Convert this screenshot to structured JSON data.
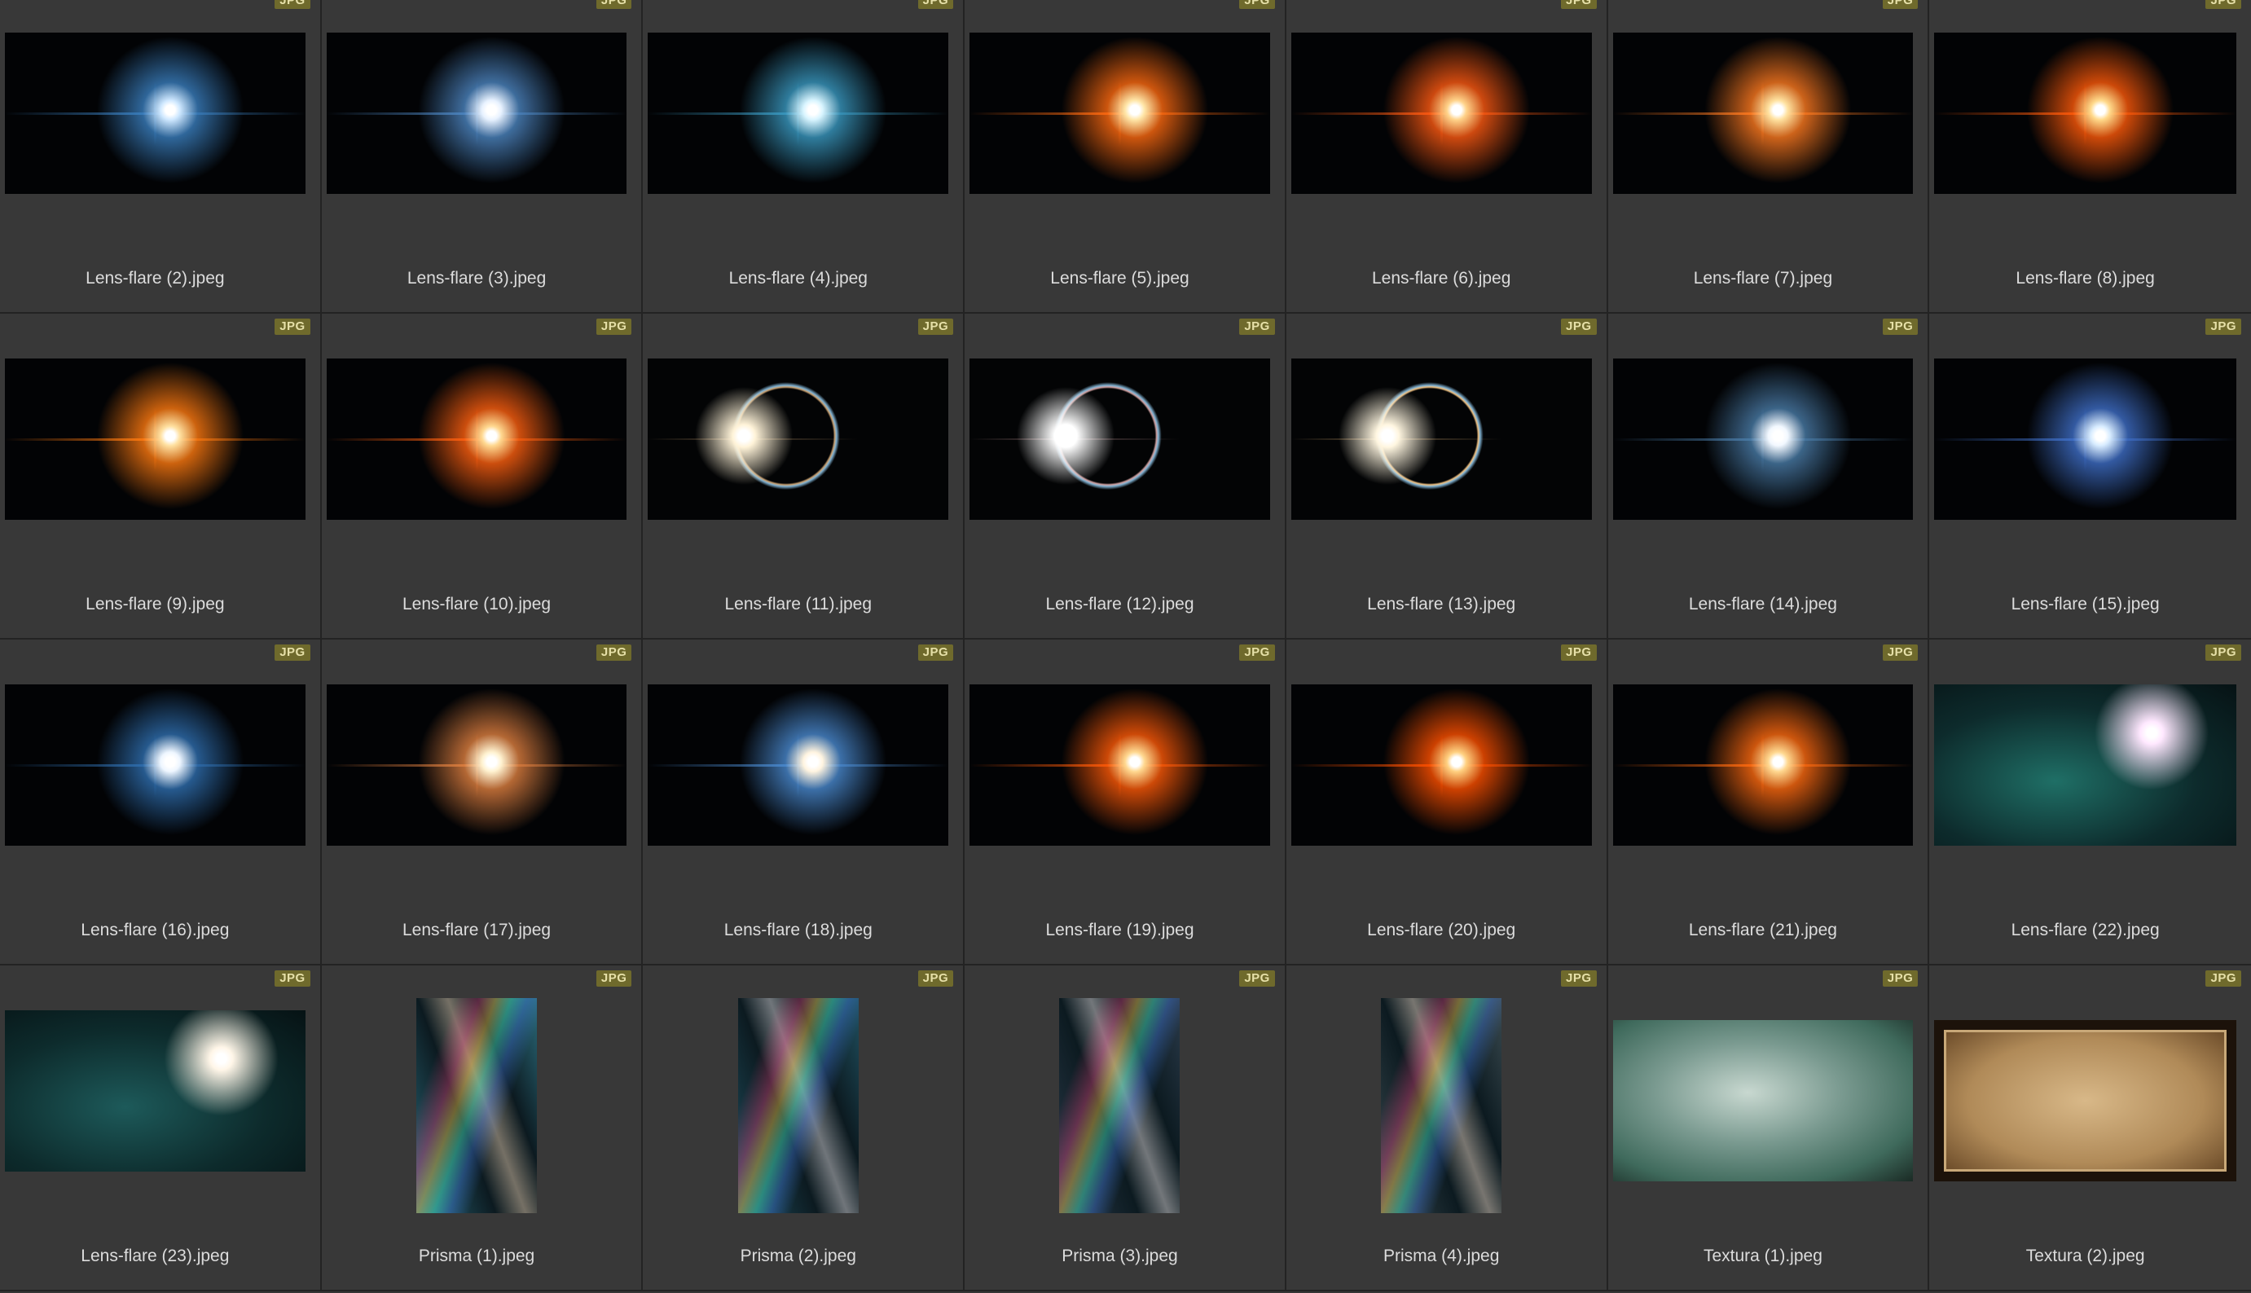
{
  "badge_label": "JPG",
  "items": [
    {
      "name": "Lens-flare (2).jpeg",
      "kind": "flare",
      "shape": "landscape",
      "glow": "#cfe8ff",
      "accent": "#3a7fbf"
    },
    {
      "name": "Lens-flare (3).jpeg",
      "kind": "flare",
      "shape": "landscape",
      "glow": "#e8f2ff",
      "accent": "#4d86c2"
    },
    {
      "name": "Lens-flare (4).jpeg",
      "kind": "flare",
      "shape": "landscape",
      "glow": "#d9f5ff",
      "accent": "#3a9ac2"
    },
    {
      "name": "Lens-flare (5).jpeg",
      "kind": "flare",
      "shape": "landscape",
      "glow": "#ffe6a8",
      "accent": "#ff6a10"
    },
    {
      "name": "Lens-flare (6).jpeg",
      "kind": "flare",
      "shape": "landscape",
      "glow": "#ffd38a",
      "accent": "#ff5a12"
    },
    {
      "name": "Lens-flare (7).jpeg",
      "kind": "flare",
      "shape": "landscape",
      "glow": "#ffe2a0",
      "accent": "#ff7a20"
    },
    {
      "name": "Lens-flare (8).jpeg",
      "kind": "flare",
      "shape": "landscape",
      "glow": "#ffd98a",
      "accent": "#ff5a0a"
    },
    {
      "name": "Lens-flare (9).jpeg",
      "kind": "flare",
      "shape": "landscape",
      "glow": "#ffe0a0",
      "accent": "#ff7a10"
    },
    {
      "name": "Lens-flare (10).jpeg",
      "kind": "flare",
      "shape": "landscape",
      "glow": "#ffd890",
      "accent": "#ff6010"
    },
    {
      "name": "Lens-flare (11).jpeg",
      "kind": "ring",
      "shape": "landscape",
      "glow": "#fff3d8",
      "accent": "#c9a070"
    },
    {
      "name": "Lens-flare (12).jpeg",
      "kind": "ring",
      "shape": "landscape",
      "glow": "#ffffff",
      "accent": "#d0a0a0"
    },
    {
      "name": "Lens-flare (13).jpeg",
      "kind": "ring",
      "shape": "landscape",
      "glow": "#fff6e0",
      "accent": "#f0c080"
    },
    {
      "name": "Lens-flare (14).jpeg",
      "kind": "flare",
      "shape": "landscape",
      "glow": "#f2f8ff",
      "accent": "#4a7ca8"
    },
    {
      "name": "Lens-flare (15).jpeg",
      "kind": "flare",
      "shape": "landscape",
      "glow": "#d8ecff",
      "accent": "#3f6fc8"
    },
    {
      "name": "Lens-flare (16).jpeg",
      "kind": "flare",
      "shape": "landscape",
      "glow": "#eef6ff",
      "accent": "#2f6fb0"
    },
    {
      "name": "Lens-flare (17).jpeg",
      "kind": "flare",
      "shape": "landscape",
      "glow": "#fff2d0",
      "accent": "#e08040"
    },
    {
      "name": "Lens-flare (18).jpeg",
      "kind": "flare",
      "shape": "landscape",
      "glow": "#fff4e0",
      "accent": "#4a8ad0"
    },
    {
      "name": "Lens-flare (19).jpeg",
      "kind": "flare",
      "shape": "landscape",
      "glow": "#ffd890",
      "accent": "#ff5a08"
    },
    {
      "name": "Lens-flare (20).jpeg",
      "kind": "flare",
      "shape": "landscape",
      "glow": "#ffd080",
      "accent": "#ff5000"
    },
    {
      "name": "Lens-flare (21).jpeg",
      "kind": "flare",
      "shape": "landscape",
      "glow": "#ffd890",
      "accent": "#ff6a10"
    },
    {
      "name": "Lens-flare (22).jpeg",
      "kind": "teal",
      "shape": "landscape",
      "glow": "#ffe8ff",
      "accent": "#1f6f66"
    },
    {
      "name": "Lens-flare (23).jpeg",
      "kind": "teal",
      "shape": "landscape",
      "glow": "#fff6e8",
      "accent": "#1d5a5a"
    },
    {
      "name": "Prisma (1).jpeg",
      "kind": "prism",
      "shape": "portrait",
      "glow": "#f0e0c0",
      "accent": "#2a6a7a"
    },
    {
      "name": "Prisma (2).jpeg",
      "kind": "prism",
      "shape": "portrait",
      "glow": "#e0f0ff",
      "accent": "#1f5060"
    },
    {
      "name": "Prisma (3).jpeg",
      "kind": "prism",
      "shape": "portrait",
      "glow": "#e8f4ff",
      "accent": "#2a3a4a"
    },
    {
      "name": "Prisma (4).jpeg",
      "kind": "prism",
      "shape": "portrait",
      "glow": "#f8f0e0",
      "accent": "#3a4a50"
    },
    {
      "name": "Textura (1).jpeg",
      "kind": "texture",
      "shape": "landscape",
      "glow": "#c8d8d0",
      "accent": "#3f6a5c"
    },
    {
      "name": "Textura (2).jpeg",
      "kind": "paper",
      "shape": "landscape",
      "glow": "#d8b888",
      "accent": "#6a4a28"
    }
  ]
}
